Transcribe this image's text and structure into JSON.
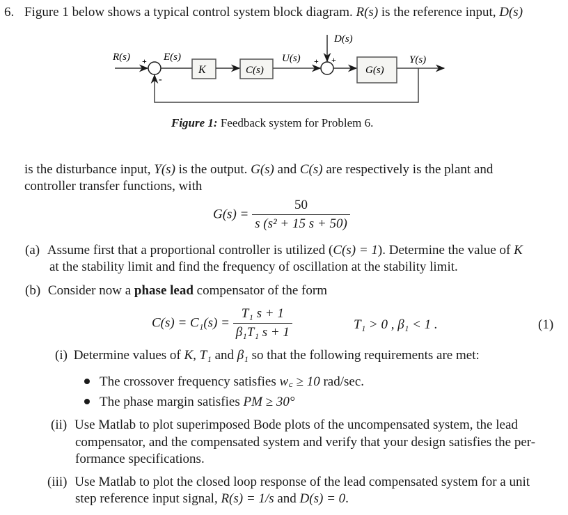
{
  "problem": {
    "number": "6.",
    "intro_line1": "Figure 1 below shows a typical control system block diagram.",
    "r_sym": "R(s)",
    "intro_mid": " is the reference input, ",
    "d_sym": "D(s)"
  },
  "figure": {
    "labels": {
      "r": "R(s)",
      "e": "E(s)",
      "k": "K",
      "c": "C(s)",
      "u": "U(s)",
      "d": "D(s)",
      "g": "G(s)",
      "y": "Y(s)",
      "plus1": "+",
      "minus1": "-",
      "plus2a": "+",
      "plus2b": "+"
    },
    "caption_label": "Figure 1:",
    "caption_text": " Feedback system for Problem 6."
  },
  "body": {
    "line1_a": "is the disturbance input, ",
    "y_sym": "Y(s)",
    "line1_b": " is the output. ",
    "g_sym": "G(s)",
    "line1_c": " and ",
    "c_sym": "C(s)",
    "line1_d": " are respectively is the plant and",
    "line2": "controller transfer functions, with"
  },
  "plant_eq": {
    "lhs": "G(s) =",
    "numerator": "50",
    "denominator": "s (s² + 15 s + 50)"
  },
  "part_a": {
    "label": "(a)",
    "line1_a": "Assume first that a proportional controller is utilized (",
    "cond": "C(s) = 1",
    "line1_b": "). Determine the value of ",
    "k_sym": "K",
    "line2": "at the stability limit and find the frequency of oscillation at the stability limit."
  },
  "part_b": {
    "label": "(b)",
    "text_a": "Consider now a ",
    "text_bold": "phase lead",
    "text_b": " compensator of the form",
    "eq_lhs": "C(s) = C₁(s) =",
    "eq_num": "T₁ s + 1",
    "eq_den": "β₁T₁ s + 1",
    "eq_cond": "T₁ > 0 ,  β₁ < 1 .",
    "eq_number": "(1)"
  },
  "part_b_i": {
    "label": "(i)",
    "text_a": "Determine values of ",
    "syms": "K, T₁",
    "text_b": " and ",
    "beta": "β₁",
    "text_c": " so that the following requirements are met:",
    "bullets": [
      {
        "text": "The crossover frequency satisfies ",
        "math": "w꜀ ≥ 10",
        "unit": " rad/sec."
      },
      {
        "text": "The phase margin satisfies ",
        "math": "PM ≥ 30°",
        "unit": ""
      }
    ]
  },
  "part_b_ii": {
    "label": "(ii)",
    "line1": "Use Matlab to plot superimposed Bode plots of the uncompensated system, the lead",
    "line2": "compensator, and the compensated system and verify that your design satisfies the per-",
    "line3": "formance specifications."
  },
  "part_b_iii": {
    "label": "(iii)",
    "line1": "Use Matlab to plot the closed loop response of the lead compensated system for a unit",
    "line2_a": "step reference input signal, ",
    "r_eq": "R(s) = 1/s",
    "line2_b": " and ",
    "d_eq": "D(s) = 0",
    "line2_c": "."
  }
}
